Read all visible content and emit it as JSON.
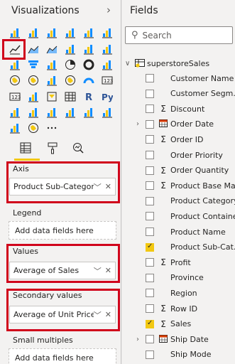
{
  "viz": {
    "title": "Visualizations",
    "tabs": [
      "build-visual",
      "format-visual",
      "analytics"
    ],
    "wells": {
      "axis": {
        "label": "Axis",
        "value": "Product Sub-Category"
      },
      "legend": {
        "label": "Legend",
        "placeholder": "Add data fields here"
      },
      "values": {
        "label": "Values",
        "value": "Average of Sales"
      },
      "secondary": {
        "label": "Secondary values",
        "value": "Average of Unit Price"
      },
      "small_multiples": {
        "label": "Small multiples",
        "placeholder": "Add data fields here"
      }
    },
    "more": "···",
    "r_label": "R",
    "py_label": "Py"
  },
  "fields": {
    "title": "Fields",
    "search_placeholder": "Search",
    "table_name": "superstoreSales",
    "items": [
      {
        "name": "Customer Name",
        "checked": false,
        "icon": ""
      },
      {
        "name": "Customer Segm...",
        "checked": false,
        "icon": ""
      },
      {
        "name": "Discount",
        "checked": false,
        "icon": "sigma"
      },
      {
        "name": "Order Date",
        "checked": false,
        "icon": "calendar",
        "expand": true
      },
      {
        "name": "Order ID",
        "checked": false,
        "icon": "sigma"
      },
      {
        "name": "Order Priority",
        "checked": false,
        "icon": ""
      },
      {
        "name": "Order Quantity",
        "checked": false,
        "icon": "sigma"
      },
      {
        "name": "Product Base Ma...",
        "checked": false,
        "icon": "sigma"
      },
      {
        "name": "Product Category",
        "checked": false,
        "icon": ""
      },
      {
        "name": "Product Container",
        "checked": false,
        "icon": ""
      },
      {
        "name": "Product Name",
        "checked": false,
        "icon": ""
      },
      {
        "name": "Product Sub-Cat...",
        "checked": true,
        "icon": ""
      },
      {
        "name": "Profit",
        "checked": false,
        "icon": "sigma"
      },
      {
        "name": "Province",
        "checked": false,
        "icon": ""
      },
      {
        "name": "Region",
        "checked": false,
        "icon": ""
      },
      {
        "name": "Row ID",
        "checked": false,
        "icon": "sigma"
      },
      {
        "name": "Sales",
        "checked": true,
        "icon": "sigma"
      },
      {
        "name": "Ship Date",
        "checked": false,
        "icon": "calendar",
        "expand": true
      },
      {
        "name": "Ship Mode",
        "checked": false,
        "icon": ""
      }
    ]
  },
  "colors": {
    "accent": "#f2c811",
    "highlight": "#d0021b"
  }
}
